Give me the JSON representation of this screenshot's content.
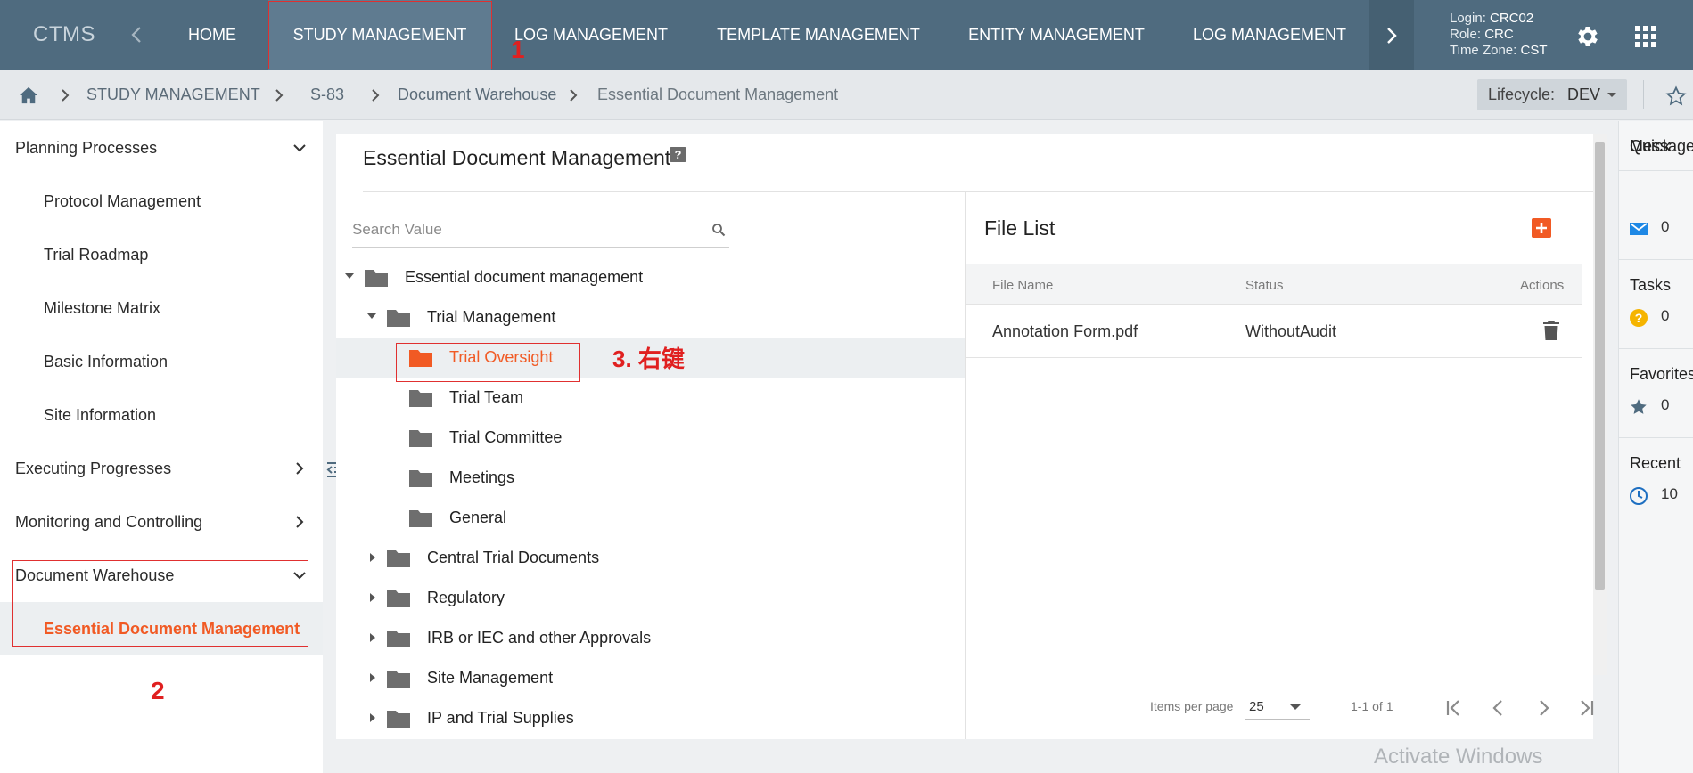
{
  "app": {
    "brand": "CTMS"
  },
  "nav": {
    "items": [
      {
        "label": "HOME"
      },
      {
        "label": "STUDY MANAGEMENT"
      },
      {
        "label": "LOG MANAGEMENT"
      },
      {
        "label": "TEMPLATE MANAGEMENT"
      },
      {
        "label": "ENTITY MANAGEMENT"
      },
      {
        "label": "LOG MANAGEMENT"
      }
    ]
  },
  "user": {
    "login_label": "Login:",
    "login": "CRC02",
    "role_label": "Role:",
    "role": "CRC",
    "tz_label": "Time Zone:",
    "tz": "CST"
  },
  "breadcrumb": [
    "STUDY MANAGEMENT",
    "S-83",
    "Document Warehouse",
    "Essential Document Management"
  ],
  "lifecycle": {
    "label": "Lifecycle:",
    "value": "DEV"
  },
  "sidebar": {
    "items": [
      {
        "label": "Planning Processes"
      },
      {
        "label": "Protocol Management"
      },
      {
        "label": "Trial Roadmap"
      },
      {
        "label": "Milestone Matrix"
      },
      {
        "label": "Basic Information"
      },
      {
        "label": "Site Information"
      },
      {
        "label": "Executing Progresses"
      },
      {
        "label": "Monitoring and Controlling"
      },
      {
        "label": "Document Warehouse"
      },
      {
        "label": "Essential Document Management"
      }
    ]
  },
  "page": {
    "title": "Essential Document Management",
    "help": "?"
  },
  "search": {
    "placeholder": "Search Value",
    "value": ""
  },
  "tree": [
    {
      "label": "Essential document management"
    },
    {
      "label": "Trial Management"
    },
    {
      "label": "Trial Oversight"
    },
    {
      "label": "Trial Team"
    },
    {
      "label": "Trial Committee"
    },
    {
      "label": "Meetings"
    },
    {
      "label": "General"
    },
    {
      "label": "Central Trial Documents"
    },
    {
      "label": "Regulatory"
    },
    {
      "label": "IRB or IEC and other Approvals"
    },
    {
      "label": "Site Management"
    },
    {
      "label": "IP and Trial Supplies"
    }
  ],
  "file_list": {
    "title": "File List",
    "columns": [
      "File Name",
      "Status",
      "Actions"
    ],
    "rows": [
      {
        "name": "Annotation Form.pdf",
        "status": "WithoutAudit"
      }
    ],
    "items_per_page_label": "Items per page",
    "items_per_page": "25",
    "range": "1-1 of 1"
  },
  "quick": {
    "title": "Quick",
    "sections": [
      {
        "title": "Message",
        "count": "0"
      },
      {
        "title": "Tasks",
        "count": "0"
      },
      {
        "title": "Favorites",
        "count": "0"
      },
      {
        "title": "Recent",
        "count": "10"
      }
    ]
  },
  "annotations": {
    "step1": "1",
    "step2": "2",
    "step3": "3. 右键"
  },
  "watermark": "Activate Windows",
  "colors": {
    "topbar": "#4f6b7f",
    "accent": "#f15a24",
    "annotation": "#e02020"
  }
}
